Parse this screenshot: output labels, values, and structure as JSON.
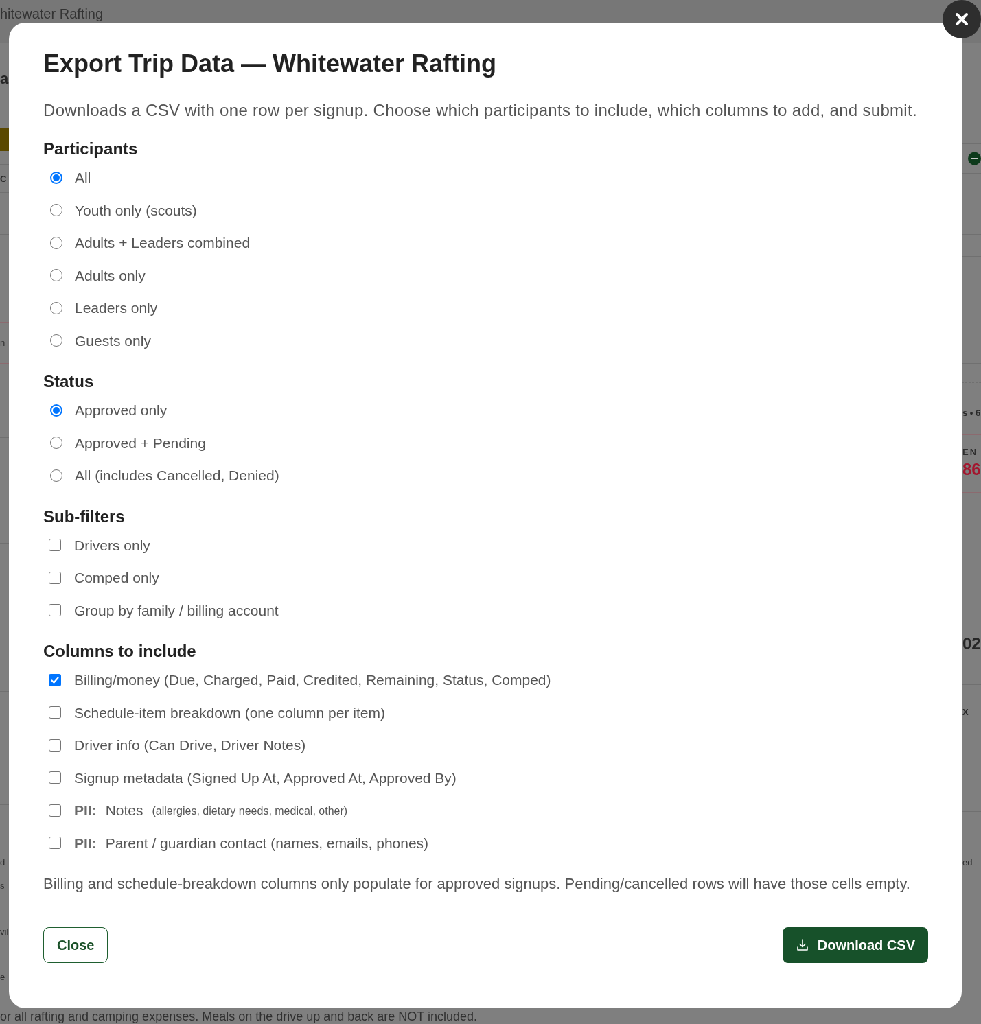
{
  "background_page": {
    "title_fragment": "hitewater Rafting",
    "left_fragments": [
      {
        "kind": "heading",
        "text": "a"
      },
      {
        "kind": "bold",
        "text": "C"
      },
      {
        "kind": "text",
        "text": "n"
      },
      {
        "kind": "text",
        "text": "d"
      },
      {
        "kind": "text",
        "text": "s"
      },
      {
        "kind": "text",
        "text": "vil"
      },
      {
        "kind": "text",
        "text": "e"
      }
    ],
    "right_fragments": [
      {
        "kind": "bold",
        "text": "s • 6"
      },
      {
        "kind": "caps",
        "text": "EN"
      },
      {
        "kind": "alert",
        "text": "86"
      },
      {
        "kind": "number",
        "text": "02"
      },
      {
        "kind": "bold",
        "text": "X"
      },
      {
        "kind": "text",
        "text": "ed"
      }
    ],
    "footer_fragment": "or all rafting and camping expenses. Meals on the drive up and back are NOT included."
  },
  "dialog": {
    "title": "Export Trip Data — Whitewater Rafting",
    "description": "Downloads a CSV with one row per signup. Choose which participants to include, which columns to add, and submit.",
    "sections": [
      {
        "kind": "radio",
        "heading": "Participants",
        "options": [
          {
            "label": "All",
            "selected": true
          },
          {
            "label": "Youth only (scouts)",
            "selected": false
          },
          {
            "label": "Adults + Leaders combined",
            "selected": false
          },
          {
            "label": "Adults only",
            "selected": false
          },
          {
            "label": "Leaders only",
            "selected": false
          },
          {
            "label": "Guests only",
            "selected": false
          }
        ]
      },
      {
        "kind": "radio",
        "heading": "Status",
        "options": [
          {
            "label": "Approved only",
            "selected": true
          },
          {
            "label": "Approved + Pending",
            "selected": false
          },
          {
            "label": "All (includes Cancelled, Denied)",
            "selected": false
          }
        ]
      },
      {
        "kind": "checkbox",
        "heading": "Sub-filters",
        "options": [
          {
            "label": "Drivers only",
            "checked": false
          },
          {
            "label": "Comped only",
            "checked": false
          },
          {
            "label": "Group by family / billing account",
            "checked": false
          }
        ]
      },
      {
        "kind": "checkbox",
        "heading": "Columns to include",
        "options": [
          {
            "label": "Billing/money (Due, Charged, Paid, Credited, Remaining, Status, Comped)",
            "checked": true
          },
          {
            "label": "Schedule-item breakdown (one column per item)",
            "checked": false
          },
          {
            "label": "Driver info (Can Drive, Driver Notes)",
            "checked": false
          },
          {
            "label": "Signup metadata (Signed Up At, Approved At, Approved By)",
            "checked": false
          },
          {
            "prefix": "PII:",
            "label": "Notes",
            "hint": "(allergies, dietary needs, medical, other)",
            "checked": false
          },
          {
            "prefix": "PII:",
            "label": "Parent / guardian contact (names, emails, phones)",
            "checked": false
          }
        ]
      }
    ],
    "note": "Billing and schedule-breakdown columns only populate for approved signups. Pending/cancelled rows will have those cells empty.",
    "buttons": [
      {
        "kind": "secondary",
        "label": "Close"
      },
      {
        "kind": "primary",
        "label": "Download CSV"
      }
    ]
  }
}
